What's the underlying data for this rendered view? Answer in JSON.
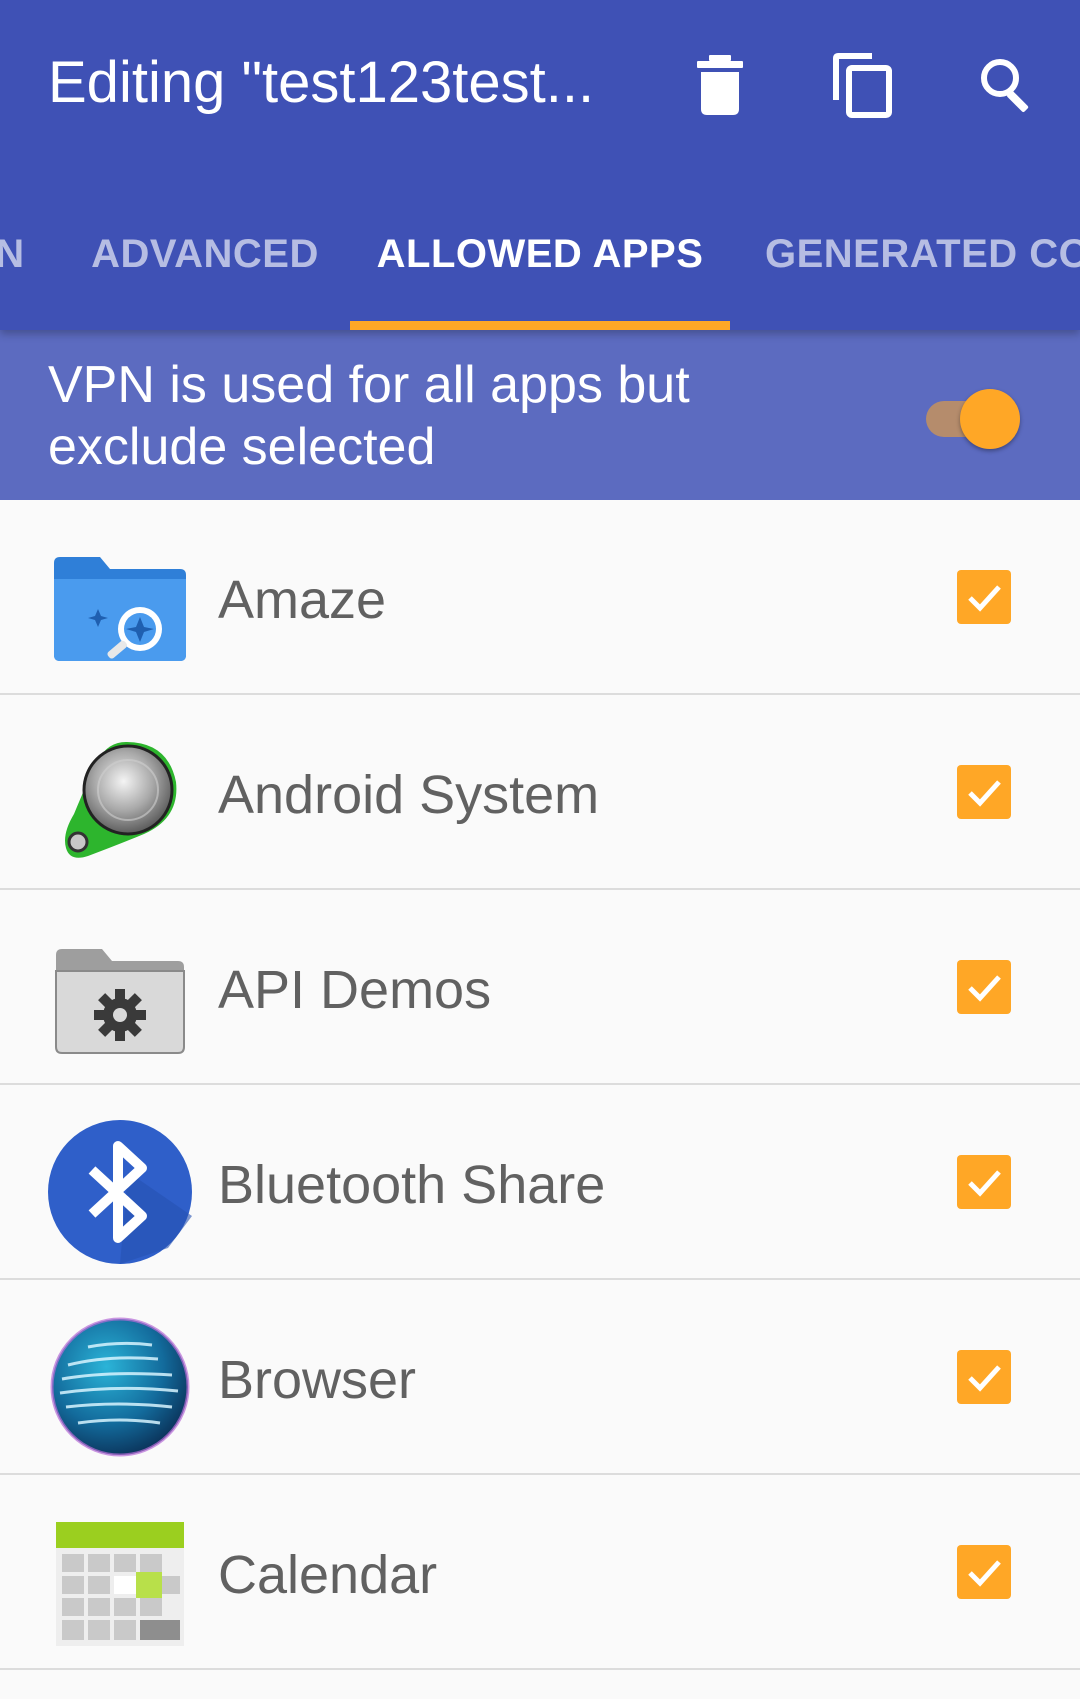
{
  "appbar": {
    "title": "Editing \"test123test...",
    "actions": {
      "delete_icon": "delete-icon",
      "copy_icon": "copy-icon",
      "search_icon": "search-icon"
    }
  },
  "tabs": [
    {
      "label": "N",
      "active": false
    },
    {
      "label": "ADVANCED",
      "active": false
    },
    {
      "label": "ALLOWED APPS",
      "active": true
    },
    {
      "label": "GENERATED CON",
      "active": false
    }
  ],
  "toggle": {
    "label": "VPN is used for all apps but exclude selected",
    "on": true
  },
  "apps": [
    {
      "name": "Amaze",
      "icon": "amaze-folder-icon",
      "checked": true
    },
    {
      "name": "Android System",
      "icon": "android-system-icon",
      "checked": true
    },
    {
      "name": "API Demos",
      "icon": "api-demos-folder-icon",
      "checked": true
    },
    {
      "name": "Bluetooth Share",
      "icon": "bluetooth-icon",
      "checked": true
    },
    {
      "name": "Browser",
      "icon": "browser-globe-icon",
      "checked": true
    },
    {
      "name": "Calendar",
      "icon": "calendar-icon",
      "checked": true
    }
  ],
  "colors": {
    "primary": "#3f51b5",
    "toggle_bar": "#5c6bc0",
    "accent": "#ffa726",
    "list_text": "#616161"
  }
}
